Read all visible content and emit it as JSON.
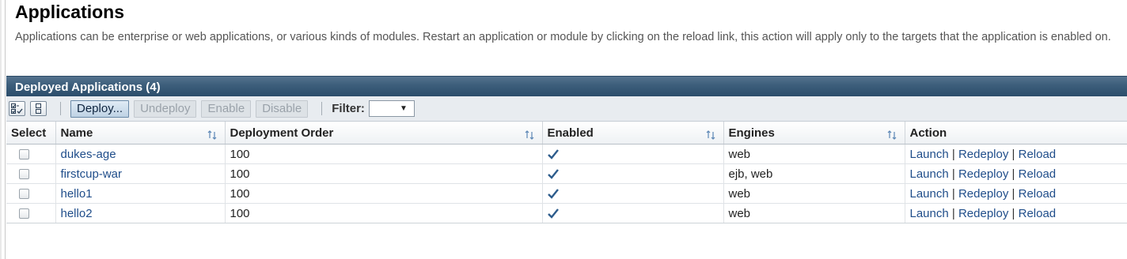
{
  "page": {
    "title": "Applications",
    "description": "Applications can be enterprise or web applications, or various kinds of modules. Restart an application or module by clicking on the reload link, this action will apply only to the targets that the application is enabled on."
  },
  "panel": {
    "title": "Deployed Applications (4)"
  },
  "toolbar": {
    "select_all_icon": "select-all-icon",
    "deselect_all_icon": "deselect-all-icon",
    "deploy_label": "Deploy...",
    "undeploy_label": "Undeploy",
    "enable_label": "Enable",
    "disable_label": "Disable",
    "filter_label": "Filter:",
    "filter_value": ""
  },
  "table": {
    "columns": [
      "Select",
      "Name",
      "Deployment Order",
      "Enabled",
      "Engines",
      "Action"
    ],
    "action_labels": [
      "Launch",
      "Redeploy",
      "Reload"
    ],
    "action_separator": "|",
    "rows": [
      {
        "name": "dukes-age",
        "order": "100",
        "enabled": true,
        "engines": "web"
      },
      {
        "name": "firstcup-war",
        "order": "100",
        "enabled": true,
        "engines": "ejb, web"
      },
      {
        "name": "hello1",
        "order": "100",
        "enabled": true,
        "engines": "web"
      },
      {
        "name": "hello2",
        "order": "100",
        "enabled": true,
        "engines": "web"
      }
    ]
  },
  "colors": {
    "header_bar": "#2b4d6b",
    "link": "#1f4d8a",
    "check": "#2d5c8c"
  }
}
